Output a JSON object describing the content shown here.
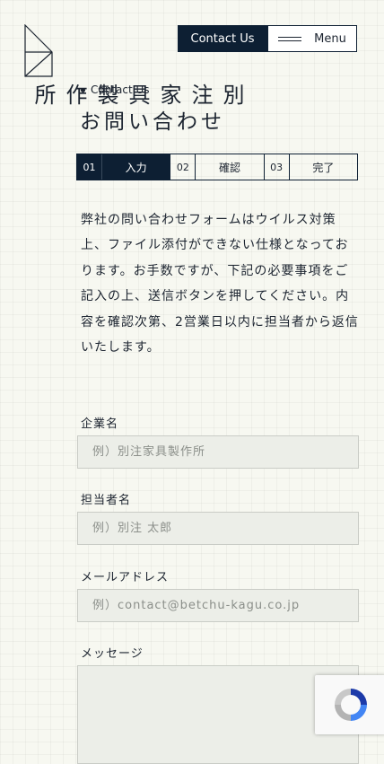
{
  "logo": {
    "text": "別注家具製作所"
  },
  "header": {
    "contact_label": "Contact Us",
    "menu_label": "Menu"
  },
  "page": {
    "eyebrow": "Contact Us",
    "title": "お問い合わせ"
  },
  "steps": [
    {
      "num": "01",
      "label": "入力",
      "active": true
    },
    {
      "num": "02",
      "label": "確認",
      "active": false
    },
    {
      "num": "03",
      "label": "完了",
      "active": false
    }
  ],
  "intro": "弊社の問い合わせフォームはウイルス対策上、ファイル添付ができない仕様となっております。お手数ですが、下記の必要事項をご記入の上、送信ボタンを押してください。内容を確認次第、2営業日以内に担当者から返信いたします。",
  "form": {
    "company": {
      "label": "企業名",
      "placeholder": "例）別注家具製作所",
      "value": ""
    },
    "person": {
      "label": "担当者名",
      "placeholder": "例）別注 太郎",
      "value": ""
    },
    "email": {
      "label": "メールアドレス",
      "placeholder": "例）contact@betchu-kagu.co.jp",
      "value": ""
    },
    "message": {
      "label": "メッセージ",
      "value": ""
    }
  },
  "recaptcha": {
    "icon": "recaptcha-icon"
  },
  "colors": {
    "navy": "#0d1f33",
    "background": "#f7f8f1",
    "input_bg": "#eceee8"
  }
}
